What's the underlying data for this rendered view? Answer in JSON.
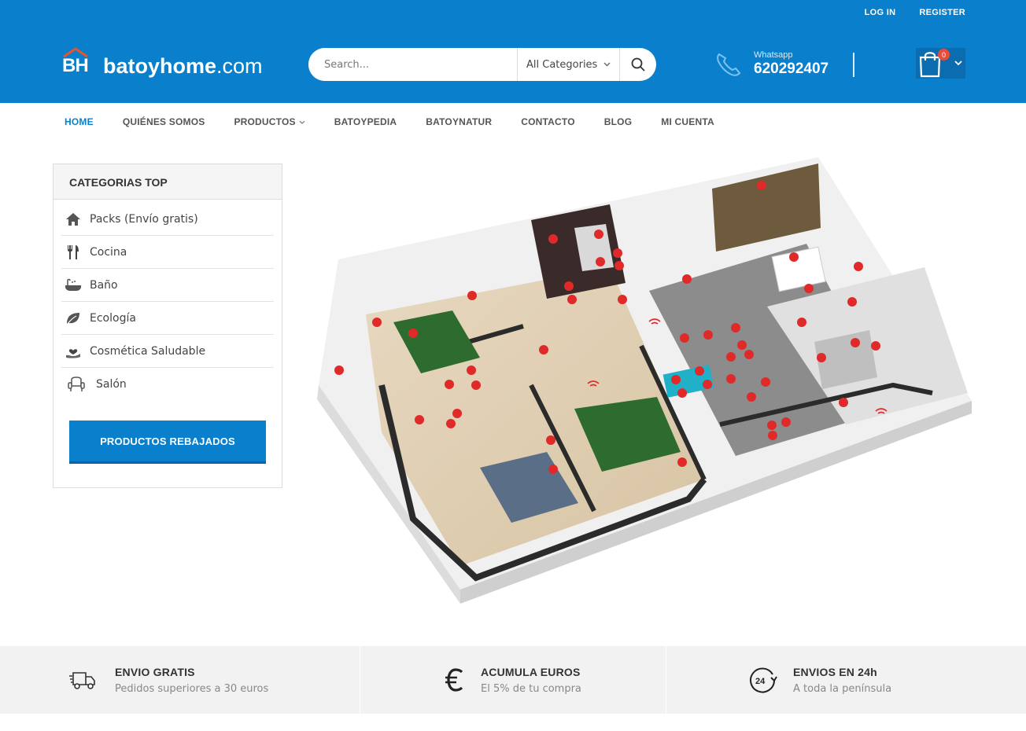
{
  "header": {
    "login": "LOG IN",
    "register": "REGISTER",
    "logo_mark": "BH",
    "logo_brand": "batoyhome",
    "logo_suffix": ".com",
    "search_placeholder": "Search...",
    "category_select": "All Categories",
    "whatsapp_label": "Whatsapp",
    "whatsapp_number": "620292407",
    "cart_count": "0"
  },
  "nav": {
    "items": [
      "HOME",
      "QUIÉNES SOMOS",
      "PRODUCTOS",
      "BATOYPEDIA",
      "BATOYNATUR",
      "CONTACTO",
      "BLOG",
      "MI CUENTA"
    ]
  },
  "sidebar": {
    "title": "CATEGORIAS TOP",
    "items": [
      {
        "label": "Packs (Envío gratis)",
        "icon": "house-icon"
      },
      {
        "label": "Cocina",
        "icon": "fork-knife-icon"
      },
      {
        "label": "Baño",
        "icon": "bathtub-icon"
      },
      {
        "label": "Ecología",
        "icon": "leaf-icon"
      },
      {
        "label": "Cosmética Saludable",
        "icon": "hand-heart-icon"
      },
      {
        "label": "Salón",
        "icon": "armchair-icon"
      }
    ],
    "promo_button": "PRODUCTOS REBAJADOS"
  },
  "features": [
    {
      "title": "ENVIO GRATIS",
      "subtitle": "Pedidos superiores a 30 euros",
      "icon": "truck-icon"
    },
    {
      "title": "ACUMULA EUROS",
      "subtitle": "El 5% de tu compra",
      "icon": "euro-icon"
    },
    {
      "title": "ENVIOS EN 24h",
      "subtitle": "A toda la península",
      "icon": "clock-24-icon"
    }
  ],
  "colors": {
    "brand_blue": "#0a7fcc",
    "hotspot_red": "#e02a2a"
  }
}
